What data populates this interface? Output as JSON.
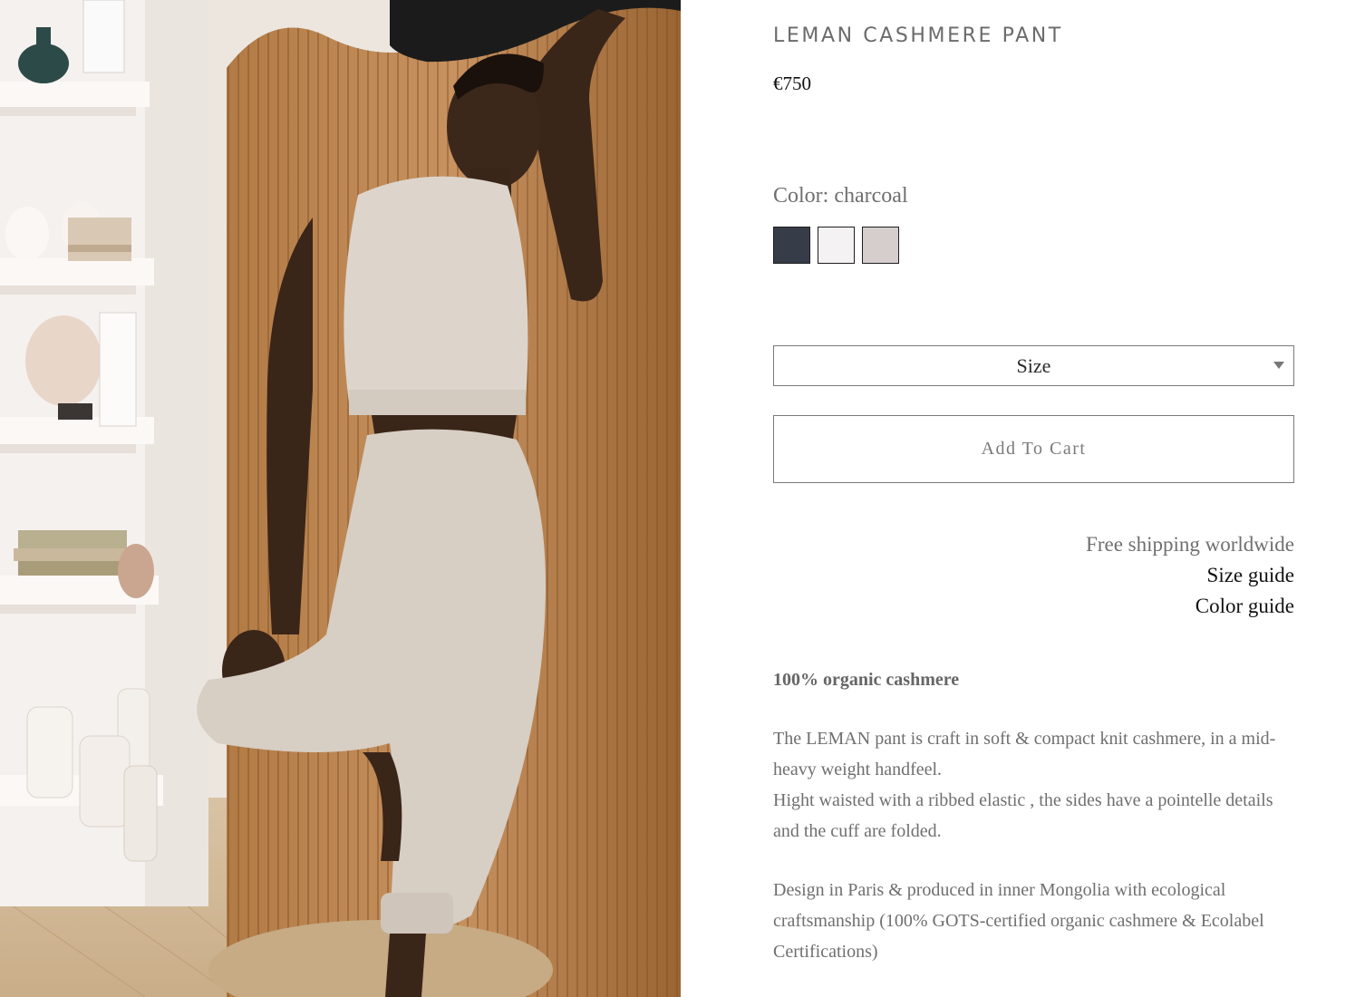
{
  "photo": {
    "alt": "Model wearing the Leman cashmere pant and knit top, leaning against a wooden slatted screen"
  },
  "product": {
    "title": "LEMAN CASHMERE PANT",
    "price": "€750"
  },
  "color": {
    "label": "Color: charcoal",
    "swatches": [
      {
        "name": "charcoal",
        "hex": "#363d49"
      },
      {
        "name": "white",
        "hex": "#f4f2f2"
      },
      {
        "name": "light taupe",
        "hex": "#d6cdcd"
      }
    ]
  },
  "size_select": {
    "label": "Size"
  },
  "cart": {
    "button_label": "Add To Cart"
  },
  "info_links": {
    "shipping": "Free shipping worldwide",
    "size_guide": "Size guide",
    "color_guide": "Color guide"
  },
  "description": {
    "headline": "100% organic cashmere",
    "line1": "The LEMAN pant is  craft in soft & compact knit cashmere, in a mid-heavy weight handfeel.",
    "line2": "Hight waisted with a ribbed elastic , the sides have a pointelle details and the cuff are folded.",
    "line3": "Design in Paris & produced in inner Mongolia with ecological craftsmanship  (100% GOTS-certified organic cashmere & Ecolabel Certifications)"
  }
}
